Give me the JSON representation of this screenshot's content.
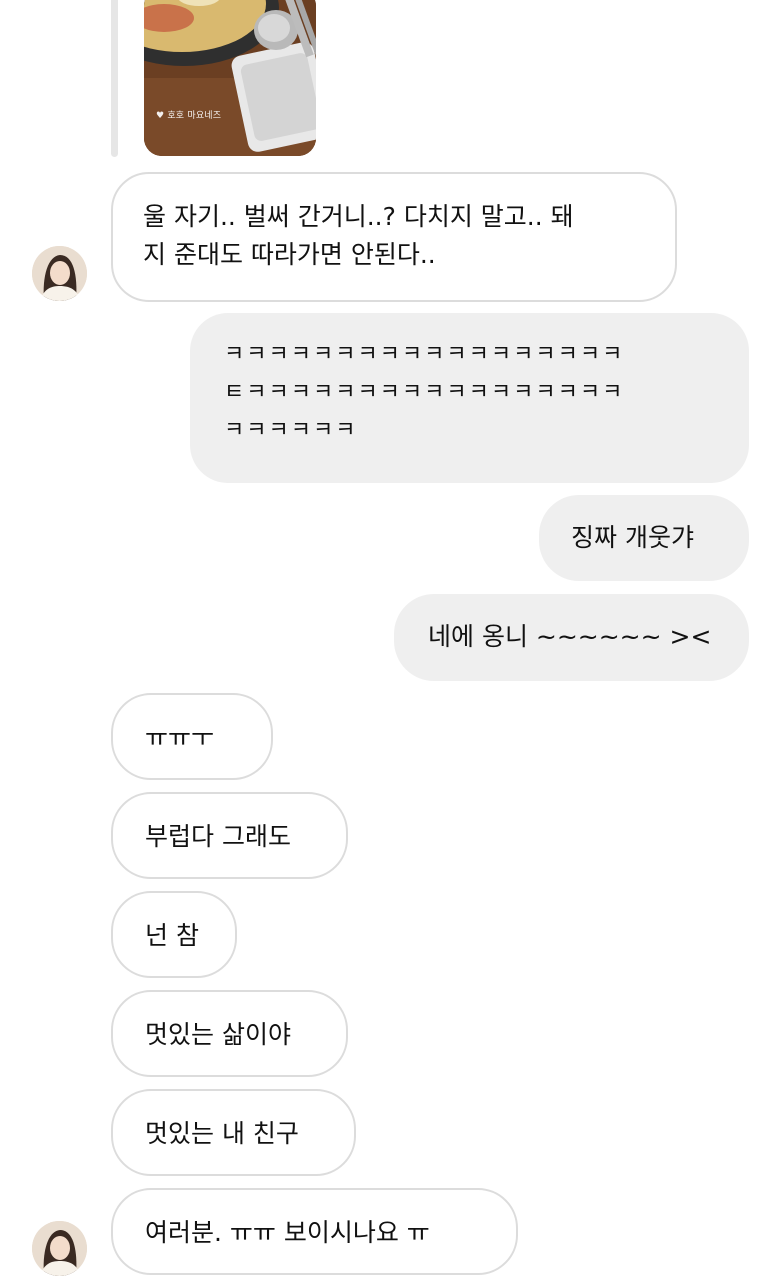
{
  "story_reply": {
    "image_caption": "♥ 호호 마요네즈"
  },
  "messages": [
    {
      "side": "incoming",
      "text": "울 자기.. 벌써 간거니..? 다치지 말고.. 돼\n지 준대도 따라가면 안된다.."
    },
    {
      "side": "outgoing",
      "text": "ㅋㅋㅋㅋㅋㅋㅋㅋㅋㅋㅋㅋㅋㅋㅋㅋㅋㅋ\nㅌㅋㅋㅋㅋㅋㅋㅋㅋㅋㅋㅋㅋㅋㅋㅋㅋㅋ\nㅋㅋㅋㅋㅋㅋ"
    },
    {
      "side": "outgoing",
      "text": "징짜 개웃갸"
    },
    {
      "side": "outgoing",
      "text": "네에 옹니 ~~~~~~ ><"
    },
    {
      "side": "incoming",
      "text": "ㅠㅠㅜ"
    },
    {
      "side": "incoming",
      "text": "부럽다 그래도"
    },
    {
      "side": "incoming",
      "text": "넌 참"
    },
    {
      "side": "incoming",
      "text": "멋있는 삶이야"
    },
    {
      "side": "incoming",
      "text": "멋있는 내 친구"
    },
    {
      "side": "incoming",
      "text": "여러분. ㅠㅠ 보이시나요 ㅠ"
    }
  ],
  "colors": {
    "incoming_bubble_bg": "#ffffff",
    "incoming_bubble_border": "#dcdcdc",
    "outgoing_bubble_bg": "#efefef",
    "text": "#111111"
  },
  "icons": {
    "avatar": "profile-photo",
    "story_image": "food-photo"
  }
}
